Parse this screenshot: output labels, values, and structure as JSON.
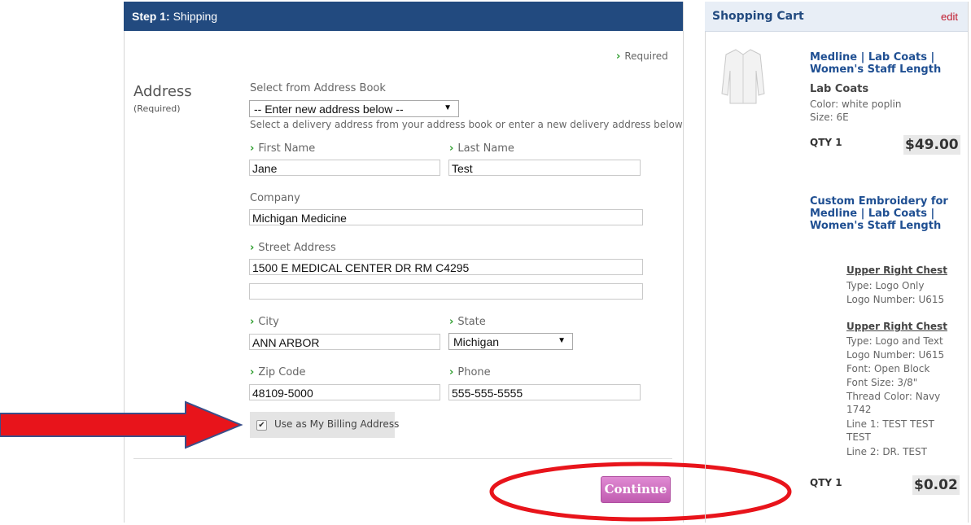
{
  "step": {
    "prefix": "Step 1:",
    "title": "Shipping"
  },
  "required_note": "Required",
  "address": {
    "heading": "Address",
    "sub": "(Required)",
    "book_label": "Select from Address Book",
    "book_value": "-- Enter new address below --",
    "book_help": "Select a delivery address from your address book or enter a new delivery address below",
    "first_name_label": "First Name",
    "first_name": "Jane",
    "last_name_label": "Last Name",
    "last_name": "Test",
    "company_label": "Company",
    "company": "Michigan Medicine",
    "street_label": "Street Address",
    "street1": "1500 E MEDICAL CENTER DR RM C4295",
    "street2": "",
    "city_label": "City",
    "city": "ANN ARBOR",
    "state_label": "State",
    "state": "Michigan",
    "zip_label": "Zip Code",
    "zip": "48109-5000",
    "phone_label": "Phone",
    "phone": "555-555-5555",
    "billing_label": "Use as My Billing Address",
    "billing_checked": true
  },
  "continue_label": "Continue",
  "cart": {
    "title": "Shopping Cart",
    "edit": "edit",
    "item1": {
      "name": "Medline | Lab Coats | Women's Staff Length",
      "category": "Lab Coats",
      "color": "Color: white poplin",
      "size": "Size: 6E",
      "qty": "QTY 1",
      "price": "$49.00"
    },
    "item2": {
      "name": "Custom Embroidery for Medline | Lab Coats | Women's Staff Length",
      "loc1_title": "Upper Right Chest",
      "loc1_type": "Type: Logo Only",
      "loc1_logo": "Logo Number: U615",
      "loc2_title": "Upper Right Chest",
      "loc2_type": "Type: Logo and Text",
      "loc2_logo": "Logo Number: U615",
      "loc2_font": "Font: Open Block",
      "loc2_size": "Font Size: 3/8\"",
      "loc2_thread": "Thread Color: Navy 1742",
      "loc2_line1": "Line 1: TEST TEST TEST",
      "loc2_line2": "Line 2: DR. TEST",
      "qty": "QTY 1",
      "price": "$0.02"
    }
  },
  "colors": {
    "header_blue": "#224a7f",
    "annotation_red": "#e8141b",
    "continue_pink": "#cc66b8",
    "required_green": "#2e9e2e"
  }
}
